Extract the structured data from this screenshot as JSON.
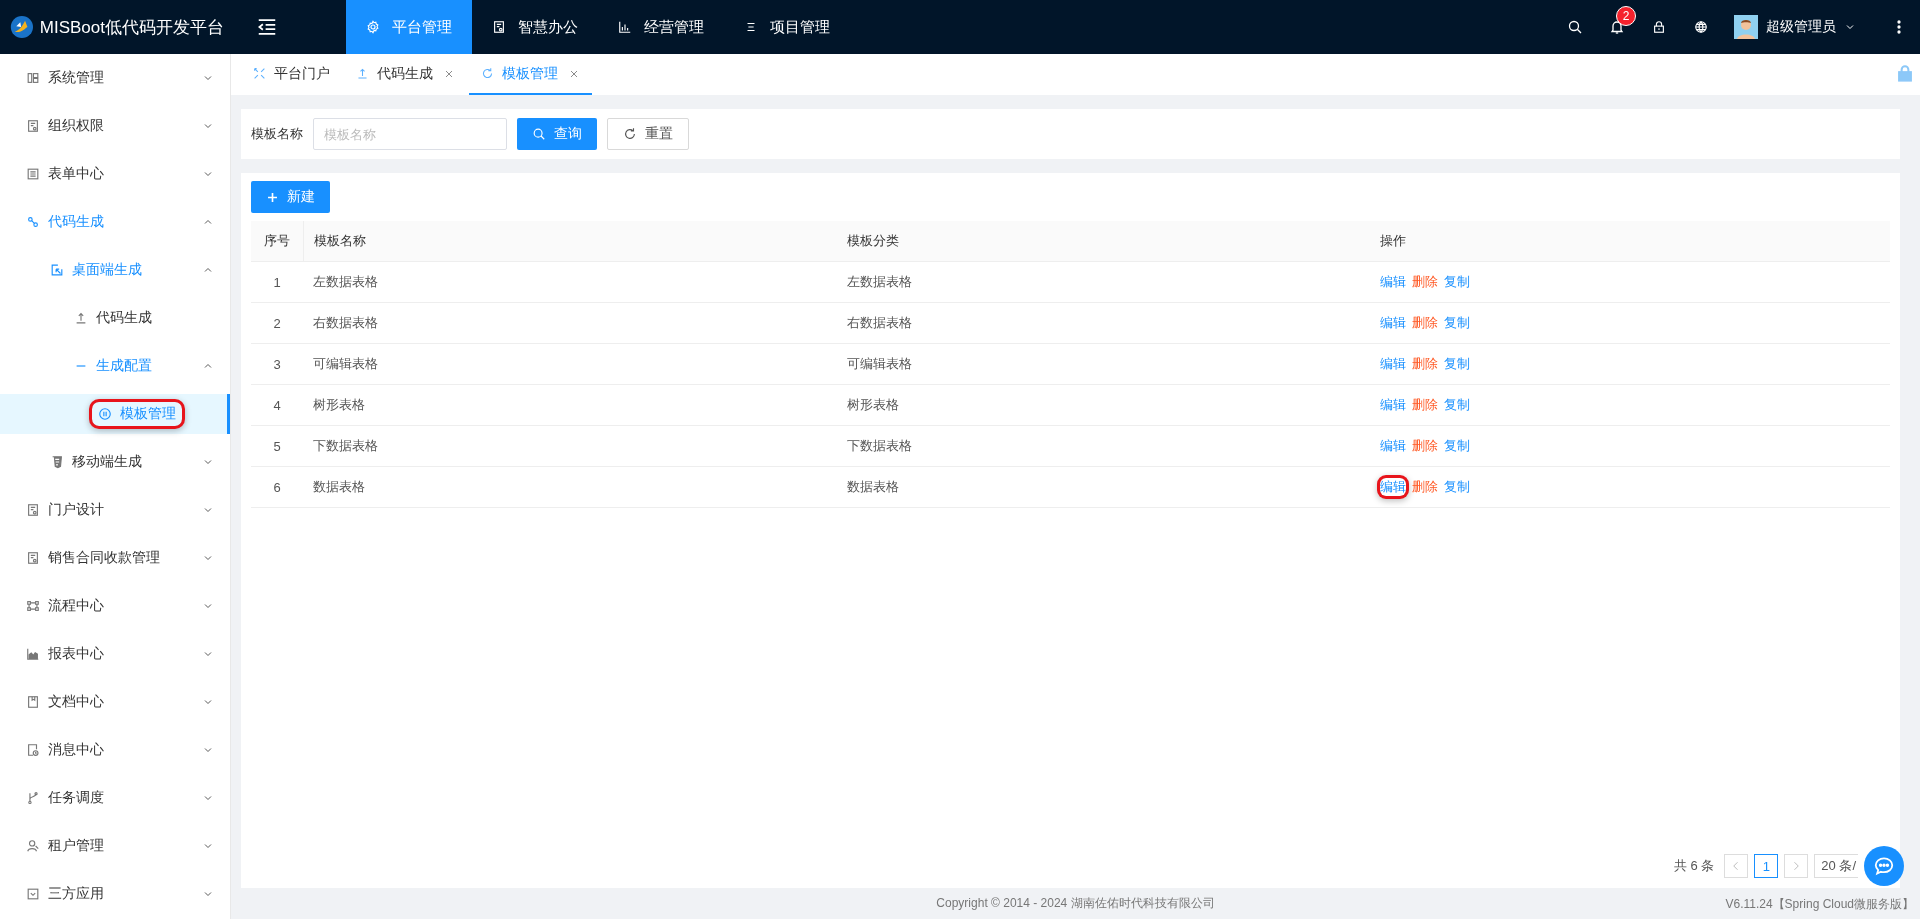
{
  "brand": {
    "title": "MISBoot低代码开发平台"
  },
  "top_nav": [
    {
      "label": "平台管理",
      "selected": true
    },
    {
      "label": "智慧办公",
      "selected": false
    },
    {
      "label": "经营管理",
      "selected": false
    },
    {
      "label": "项目管理",
      "selected": false
    }
  ],
  "header": {
    "notification_count": "2",
    "user_name": "超级管理员"
  },
  "sidebar": {
    "items": [
      {
        "label": "系统管理",
        "expanded": false,
        "selected": false
      },
      {
        "label": "组织权限",
        "expanded": false,
        "selected": false
      },
      {
        "label": "表单中心",
        "expanded": false,
        "selected": false
      },
      {
        "label": "代码生成",
        "expanded": true,
        "selected": false,
        "children": [
          {
            "label": "桌面端生成",
            "expanded": true,
            "selected": false,
            "children": [
              {
                "label": "代码生成",
                "selected": false
              },
              {
                "label": "生成配置",
                "expanded": true,
                "selected": false,
                "children": [
                  {
                    "label": "模板管理",
                    "selected": true,
                    "highlighted": true
                  }
                ]
              }
            ]
          },
          {
            "label": "移动端生成",
            "expanded": false,
            "selected": false
          }
        ]
      },
      {
        "label": "门户设计",
        "expanded": false,
        "selected": false
      },
      {
        "label": "销售合同收款管理",
        "expanded": false,
        "selected": false
      },
      {
        "label": "流程中心",
        "expanded": false,
        "selected": false
      },
      {
        "label": "报表中心",
        "expanded": false,
        "selected": false
      },
      {
        "label": "文档中心",
        "expanded": false,
        "selected": false
      },
      {
        "label": "消息中心",
        "expanded": false,
        "selected": false
      },
      {
        "label": "任务调度",
        "expanded": false,
        "selected": false
      },
      {
        "label": "租户管理",
        "expanded": false,
        "selected": false
      },
      {
        "label": "三方应用",
        "expanded": false,
        "selected": false
      }
    ]
  },
  "tabs": [
    {
      "label": "平台门户",
      "selected": false,
      "closable": false
    },
    {
      "label": "代码生成",
      "selected": false,
      "closable": true
    },
    {
      "label": "模板管理",
      "selected": true,
      "closable": true
    }
  ],
  "search": {
    "label": "模板名称",
    "placeholder": "模板名称",
    "buttons": [
      {
        "label": "查询",
        "kind": "primary"
      },
      {
        "label": "重置",
        "kind": "default"
      }
    ]
  },
  "toolbar": {
    "new_button": "新建"
  },
  "table": {
    "columns": [
      "序号",
      "模板名称",
      "模板分类",
      "操作"
    ],
    "rows": [
      {
        "index": "1",
        "name": "左数据表格",
        "category": "左数据表格",
        "actions": [
          {
            "label": "编辑",
            "kind": "edit",
            "highlighted": false
          },
          {
            "label": "删除",
            "kind": "delete",
            "highlighted": false
          },
          {
            "label": "复制",
            "kind": "copy",
            "highlighted": false
          }
        ]
      },
      {
        "index": "2",
        "name": "右数据表格",
        "category": "右数据表格",
        "actions": [
          {
            "label": "编辑",
            "kind": "edit",
            "highlighted": false
          },
          {
            "label": "删除",
            "kind": "delete",
            "highlighted": false
          },
          {
            "label": "复制",
            "kind": "copy",
            "highlighted": false
          }
        ]
      },
      {
        "index": "3",
        "name": "可编辑表格",
        "category": "可编辑表格",
        "actions": [
          {
            "label": "编辑",
            "kind": "edit",
            "highlighted": false
          },
          {
            "label": "删除",
            "kind": "delete",
            "highlighted": false
          },
          {
            "label": "复制",
            "kind": "copy",
            "highlighted": false
          }
        ]
      },
      {
        "index": "4",
        "name": "树形表格",
        "category": "树形表格",
        "actions": [
          {
            "label": "编辑",
            "kind": "edit",
            "highlighted": false
          },
          {
            "label": "删除",
            "kind": "delete",
            "highlighted": false
          },
          {
            "label": "复制",
            "kind": "copy",
            "highlighted": false
          }
        ]
      },
      {
        "index": "5",
        "name": "下数据表格",
        "category": "下数据表格",
        "actions": [
          {
            "label": "编辑",
            "kind": "edit",
            "highlighted": false
          },
          {
            "label": "删除",
            "kind": "delete",
            "highlighted": false
          },
          {
            "label": "复制",
            "kind": "copy",
            "highlighted": false
          }
        ]
      },
      {
        "index": "6",
        "name": "数据表格",
        "category": "数据表格",
        "actions": [
          {
            "label": "编辑",
            "kind": "edit",
            "highlighted": true
          },
          {
            "label": "删除",
            "kind": "delete",
            "highlighted": false
          },
          {
            "label": "复制",
            "kind": "copy",
            "highlighted": false
          }
        ]
      }
    ]
  },
  "pagination": {
    "total": "共 6 条",
    "pages": [
      {
        "label": "1",
        "selected": true
      }
    ],
    "page_size": "20 条/"
  },
  "footer": {
    "copyright": "Copyright © 2014 - 2024 湖南佐佑时代科技有限公司",
    "version": "V6.11.24【Spring Cloud微服务版】"
  }
}
